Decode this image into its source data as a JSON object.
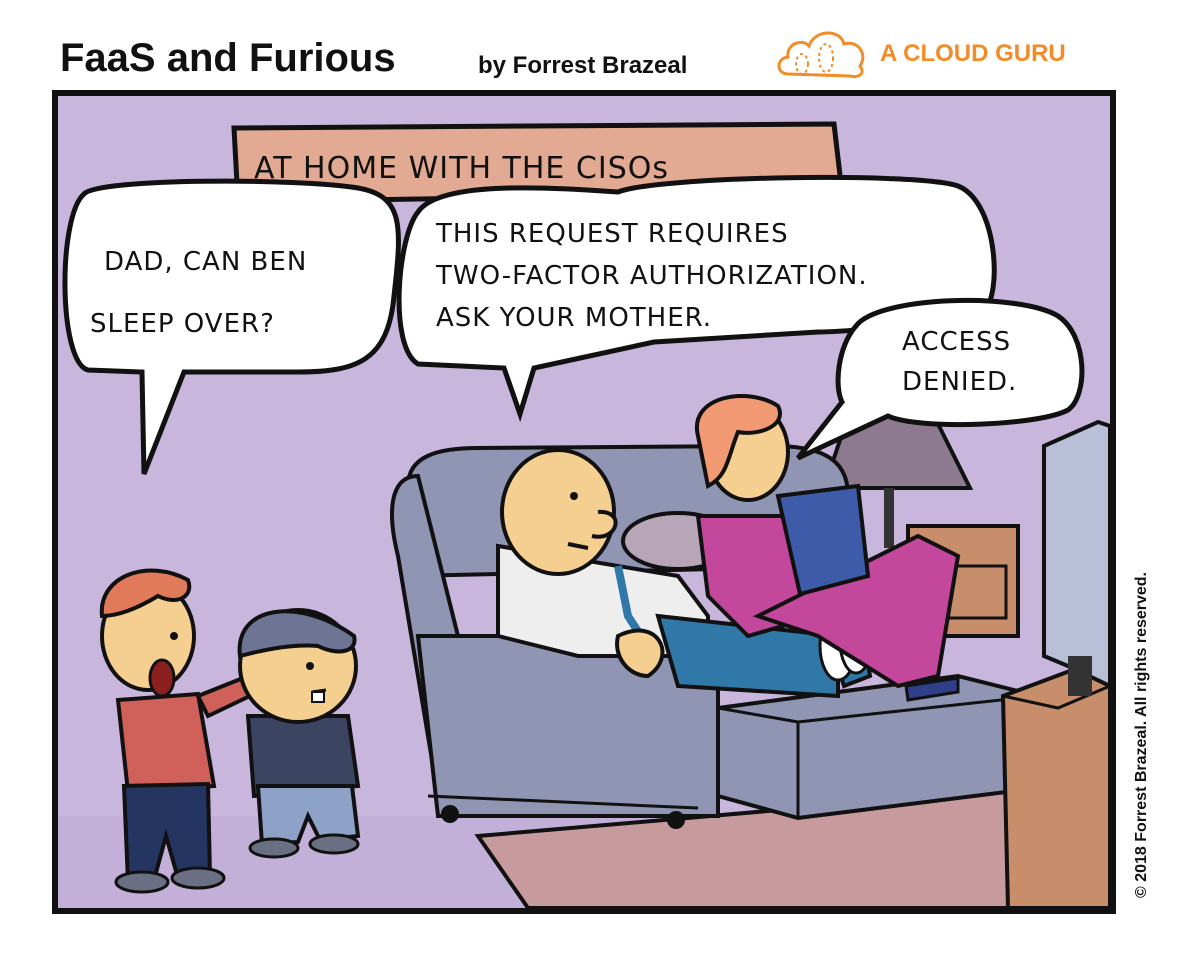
{
  "header": {
    "title": "FaaS and Furious",
    "byline": "by Forrest Brazeal",
    "brand": "A CLOUD GURU",
    "brand_color": "#f28c28"
  },
  "copyright": "© 2018 Forrest Brazeal. All rights reserved.",
  "panel": {
    "caption": "AT HOME WITH THE CISOs",
    "bubbles": {
      "kid": [
        "DAD, CAN BEN",
        "SLEEP OVER?"
      ],
      "dad": [
        "THIS REQUEST REQUIRES",
        "TWO-FACTOR AUTHORIZATION.",
        "ASK YOUR MOTHER."
      ],
      "mom": [
        "ACCESS",
        "DENIED."
      ]
    }
  },
  "colors": {
    "wall": "#c8b6dd",
    "couch": "#8f95b2",
    "caption_box": "#e2aa92",
    "rug": "#c79b9d",
    "table": "#c88d6a"
  }
}
